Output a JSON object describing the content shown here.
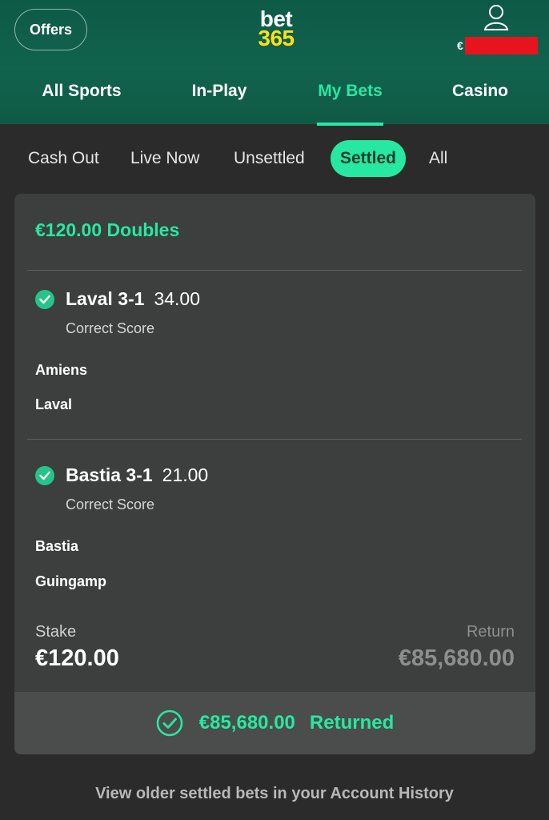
{
  "header": {
    "offers_label": "Offers",
    "logo_top": "bet",
    "logo_bottom": "365",
    "balance_currency": "€",
    "colors": {
      "brand_green": "#11634d",
      "accent": "#26e8a3",
      "logo_yellow": "#ffdf1b",
      "redaction": "#e8141d"
    }
  },
  "nav": {
    "items": [
      {
        "label": "All Sports"
      },
      {
        "label": "In-Play"
      },
      {
        "label": "My Bets"
      },
      {
        "label": "Casino"
      }
    ],
    "active": "My Bets"
  },
  "filters": {
    "items": [
      {
        "label": "Cash Out"
      },
      {
        "label": "Live Now"
      },
      {
        "label": "Unsettled"
      },
      {
        "label": "Settled"
      },
      {
        "label": "All"
      }
    ],
    "active": "Settled"
  },
  "bet": {
    "title": "€120.00 Doubles",
    "selections": [
      {
        "name": "Laval 3-1",
        "odds": "34.00",
        "market": "Correct Score",
        "team1": "Amiens",
        "team2": "Laval",
        "status_icon": "check-circle-icon"
      },
      {
        "name": "Bastia 3-1",
        "odds": "21.00",
        "market": "Correct Score",
        "team1": "Bastia",
        "team2": "Guingamp",
        "status_icon": "check-circle-icon"
      }
    ],
    "stake_label": "Stake",
    "stake_value": "€120.00",
    "return_label": "Return",
    "return_value": "€85,680.00",
    "returned_amount": "€85,680.00",
    "returned_text": "Returned"
  },
  "footer": {
    "link_text": "View older settled bets in your Account History"
  }
}
